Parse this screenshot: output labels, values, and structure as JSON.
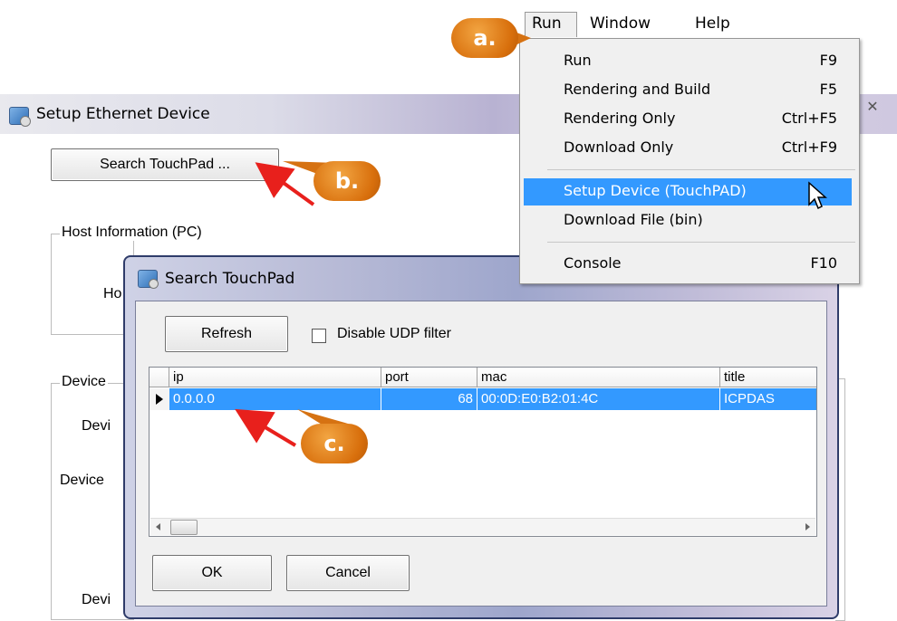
{
  "setup_window": {
    "title": "Setup Ethernet Device",
    "close_glyph": "✕",
    "search_button": "Search TouchPad ...",
    "host_group_label": "Host Information (PC)",
    "host_field_fragment": "Ho",
    "device_group_label": "Device",
    "background_labels": [
      "Devi",
      "Device",
      "Devi"
    ]
  },
  "search_dialog": {
    "title": "Search TouchPad",
    "refresh_button": "Refresh",
    "disable_udp_label": "Disable UDP filter",
    "disable_udp_checked": false,
    "columns": [
      "ip",
      "port",
      "mac",
      "title"
    ],
    "rows": [
      {
        "ip": "0.0.0.0",
        "port": "68",
        "mac": "00:0D:E0:B2:01:4C",
        "title": "ICPDAS"
      }
    ],
    "ok_button": "OK",
    "cancel_button": "Cancel"
  },
  "menubar": {
    "items": [
      "Run",
      "Window",
      "Help"
    ],
    "active": "Run"
  },
  "run_menu": {
    "items": [
      {
        "label": "Run",
        "shortcut": "F9"
      },
      {
        "label": "Rendering and Build",
        "shortcut": "F5"
      },
      {
        "label": "Rendering Only",
        "shortcut": "Ctrl+F5"
      },
      {
        "label": "Download Only",
        "shortcut": "Ctrl+F9"
      },
      {
        "label": "Setup Device (TouchPAD)",
        "shortcut": ""
      },
      {
        "label": "Download File (bin)",
        "shortcut": ""
      },
      {
        "label": "Console",
        "shortcut": "F10"
      }
    ],
    "highlighted": "Setup Device (TouchPAD)"
  },
  "callouts": {
    "a": "a.",
    "b": "b.",
    "c": "c."
  },
  "colors": {
    "selection": "#3399ff",
    "callout": "#e07f1a",
    "arrow": "#e8201c"
  }
}
